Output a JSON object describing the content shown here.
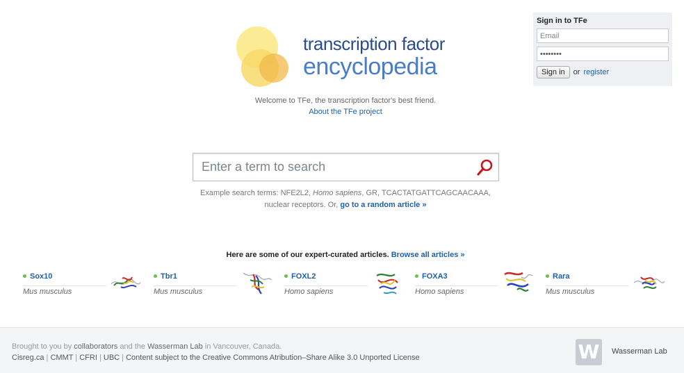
{
  "signin": {
    "title": "Sign in to TFe",
    "email_placeholder": "Email",
    "password_value": "password",
    "button": "Sign in",
    "or_text": "or",
    "register": "register"
  },
  "logo": {
    "line1": "transcription factor",
    "line2": "encyclopedia",
    "colors": {
      "circle_light": "#fbe98a",
      "circle_mid": "#f7d96a",
      "circle_orange": "#f1b94a"
    }
  },
  "welcome": "Welcome to TFe, the transcription factor's best friend.",
  "about_link": "About the TFe project",
  "search": {
    "placeholder": "Enter a term to search",
    "icon": "search-icon",
    "icon_color": "#c8141a"
  },
  "examples": {
    "prefix": "Example search terms: NFE2L2, ",
    "italic_term": "Homo sapiens",
    "rest": ", GR, TCACTATGATTCAGCAACAAA, nuclear receptors. Or, ",
    "random_link": "go to a random article »"
  },
  "curated": {
    "heading": "Here are some of our expert-curated articles.",
    "browse_link": "Browse all articles »",
    "articles": [
      {
        "name": "Sox10",
        "species": "Mus musculus"
      },
      {
        "name": "Tbr1",
        "species": "Mus musculus"
      },
      {
        "name": "FOXL2",
        "species": "Homo sapiens"
      },
      {
        "name": "FOXA3",
        "species": "Homo sapiens"
      },
      {
        "name": "Rara",
        "species": "Mus musculus"
      }
    ]
  },
  "footer": {
    "brought": "Brought to you by ",
    "collaborators": "collaborators",
    "and_the": " and the ",
    "lab_link": "Wasserman Lab",
    "in_city": " in Vancouver, Canada.",
    "links": [
      "Cisreg.ca",
      "CMMT",
      "CFRI",
      "UBC"
    ],
    "license": "Content subject to the Creative Commons Atribution–Share Alike 3.0 Unported License",
    "logo_letter": "W",
    "lab_name": "Wasserman Lab"
  },
  "accent_colors": {
    "link": "#1f5fa8",
    "dot": "#6cc04a"
  }
}
